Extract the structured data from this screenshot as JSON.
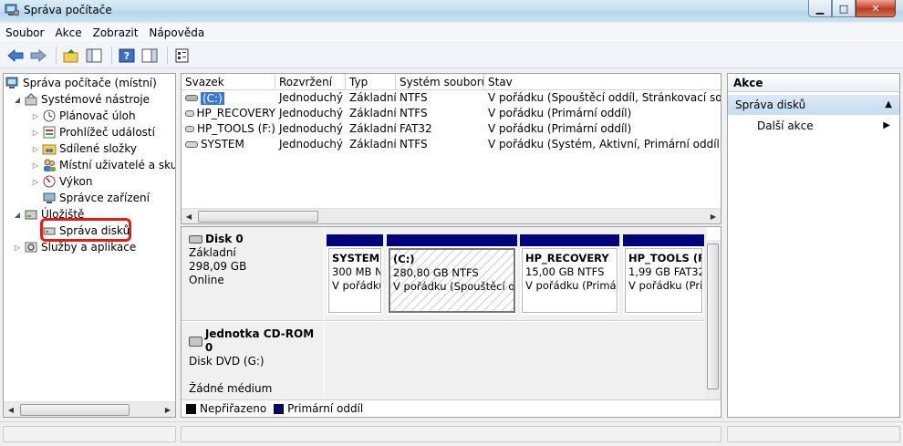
{
  "window": {
    "title": "Správa počítače"
  },
  "menu": [
    "Soubor",
    "Akce",
    "Zobrazit",
    "Nápověda"
  ],
  "tree": {
    "root": "Správa počítače (místní)",
    "system_tools": "Systémové nástroje",
    "task_scheduler": "Plánovač úloh",
    "event_viewer": "Prohlížeč událostí",
    "shared_folders": "Sdílené složky",
    "local_users": "Místní uživatelé a skupiny",
    "performance": "Výkon",
    "device_manager": "Správce zařízení",
    "storage": "Úložiště",
    "disk_management": "Správa disků",
    "services": "Služby a aplikace"
  },
  "volumes": {
    "columns": [
      "Svazek",
      "Rozvržení",
      "Typ",
      "Systém souborů",
      "Stav"
    ],
    "rows": [
      {
        "name": "(C:)",
        "layout": "Jednoduchý",
        "type": "Základní",
        "fs": "NTFS",
        "status": "V pořádku (Spouštěcí oddíl, Stránkovací soubor, Výpis"
      },
      {
        "name": "HP_RECOVERY",
        "layout": "Jednoduchý",
        "type": "Základní",
        "fs": "NTFS",
        "status": "V pořádku (Primární oddíl)"
      },
      {
        "name": "HP_TOOLS (F:)",
        "layout": "Jednoduchý",
        "type": "Základní",
        "fs": "FAT32",
        "status": "V pořádku (Primární oddíl)"
      },
      {
        "name": "SYSTEM",
        "layout": "Jednoduchý",
        "type": "Základní",
        "fs": "NTFS",
        "status": "V pořádku (Systém, Aktivní, Primární oddíl)"
      }
    ]
  },
  "disks": {
    "disk0": {
      "name": "Disk 0",
      "type": "Základní",
      "size": "298,09 GB",
      "state": "Online",
      "partitions": [
        {
          "name": "SYSTEM",
          "size": "300 MB NTFS",
          "status": "V pořádku (Systém"
        },
        {
          "name": "(C:)",
          "size": "280,80 GB NTFS",
          "status": "V pořádku (Spouštěcí oddíl"
        },
        {
          "name": "HP_RECOVERY",
          "size": "15,00 GB NTFS",
          "status": "V pořádku (Primární oddíl)"
        },
        {
          "name": "HP_TOOLS (F:)",
          "size": "1,99 GB FAT32",
          "status": "V pořádku (Primární"
        }
      ]
    },
    "cdrom0": {
      "name": "Jednotka CD-ROM 0",
      "type": "Disk DVD (G:)",
      "state": "Žádné médium"
    }
  },
  "legend": {
    "unallocated": "Nepřiřazeno",
    "primary": "Primární oddíl"
  },
  "actions": {
    "header": "Akce",
    "section": "Správa disků",
    "more": "Další akce"
  },
  "colors": {
    "primary_partition": "#00007a",
    "unallocated": "#000000",
    "highlight_ring": "#e51a1a"
  }
}
